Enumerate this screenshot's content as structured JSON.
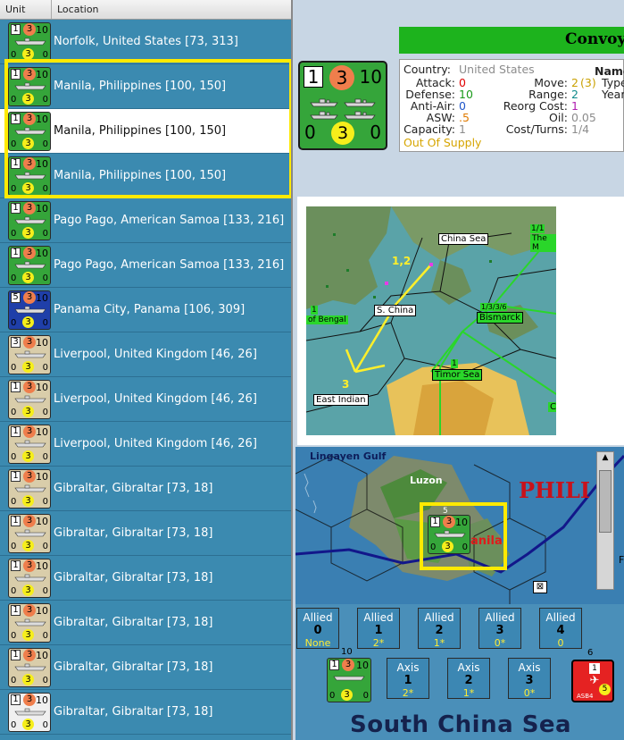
{
  "list": {
    "headers": {
      "unit": "Unit",
      "location": "Location"
    },
    "rows": [
      {
        "location": "Norfolk, United States [73, 313]",
        "color": "green",
        "a": "1",
        "m": "3",
        "r": "10",
        "d": "0",
        "s": "3",
        "x": "0"
      },
      {
        "location": "Manila, Philippines [100, 150]",
        "color": "green",
        "a": "1",
        "m": "3",
        "r": "10",
        "d": "0",
        "s": "3",
        "x": "0"
      },
      {
        "location": "Manila, Philippines [100, 150]",
        "color": "green",
        "a": "1",
        "m": "3",
        "r": "10",
        "d": "0",
        "s": "3",
        "x": "0",
        "selected": true
      },
      {
        "location": "Manila, Philippines [100, 150]",
        "color": "green",
        "a": "1",
        "m": "3",
        "r": "10",
        "d": "0",
        "s": "3",
        "x": "0"
      },
      {
        "location": "Pago Pago, American Samoa [133, 216]",
        "color": "green",
        "a": "1",
        "m": "3",
        "r": "10",
        "d": "0",
        "s": "3",
        "x": "0"
      },
      {
        "location": "Pago Pago, American Samoa [133, 216]",
        "color": "green",
        "a": "1",
        "m": "3",
        "r": "10",
        "d": "0",
        "s": "3",
        "x": "0"
      },
      {
        "location": "Panama City, Panama [106, 309]",
        "color": "blue",
        "a": "5",
        "m": "3",
        "r": "10",
        "d": "0",
        "s": "3",
        "x": "0"
      },
      {
        "location": "Liverpool, United Kingdom [46, 26]",
        "color": "tan",
        "a": "3",
        "m": "3",
        "r": "10",
        "d": "0",
        "s": "3",
        "x": "0"
      },
      {
        "location": "Liverpool, United Kingdom [46, 26]",
        "color": "tan",
        "a": "1",
        "m": "3",
        "r": "10",
        "d": "0",
        "s": "3",
        "x": "0"
      },
      {
        "location": "Liverpool, United Kingdom [46, 26]",
        "color": "tan",
        "a": "1",
        "m": "3",
        "r": "10",
        "d": "0",
        "s": "3",
        "x": "0"
      },
      {
        "location": "Gibraltar, Gibraltar [73, 18]",
        "color": "tan",
        "a": "1",
        "m": "3",
        "r": "10",
        "d": "0",
        "s": "3",
        "x": "0"
      },
      {
        "location": "Gibraltar, Gibraltar [73, 18]",
        "color": "tan",
        "a": "1",
        "m": "3",
        "r": "10",
        "d": "0",
        "s": "3",
        "x": "0"
      },
      {
        "location": "Gibraltar, Gibraltar [73, 18]",
        "color": "tan",
        "a": "1",
        "m": "3",
        "r": "10",
        "d": "0",
        "s": "3",
        "x": "0"
      },
      {
        "location": "Gibraltar, Gibraltar [73, 18]",
        "color": "tan",
        "a": "1",
        "m": "3",
        "r": "10",
        "d": "0",
        "s": "3",
        "x": "0"
      },
      {
        "location": "Gibraltar, Gibraltar [73, 18]",
        "color": "tan",
        "a": "1",
        "m": "3",
        "r": "10",
        "d": "0",
        "s": "3",
        "x": "0"
      },
      {
        "location": "Gibraltar, Gibraltar [73, 18]",
        "color": "white",
        "a": "1",
        "m": "3",
        "r": "10",
        "d": "0",
        "s": "3",
        "x": "0"
      }
    ]
  },
  "detail": {
    "title": "Convoy",
    "counter": {
      "a": "1",
      "m": "3",
      "r": "10",
      "d": "0",
      "s": "3",
      "x": "0"
    },
    "country_label": "Country:",
    "country": "United States",
    "attack_label": "Attack:",
    "attack": "0",
    "defense_label": "Defense:",
    "defense": "10",
    "antiair_label": "Anti-Air:",
    "antiair": "0",
    "asw_label": "ASW:",
    "asw": ".5",
    "capacity_label": "Capacity:",
    "capacity": "1",
    "move_label": "Move:",
    "move": "2",
    "move_extra": "(3)",
    "range_label": "Range:",
    "range": "2",
    "reorg_label": "Reorg Cost:",
    "reorg": "1",
    "oil_label": "Oil:",
    "oil": "0.05",
    "cost_label": "Cost/Turns:",
    "cost": "1/4",
    "supply": "Out Of Supply",
    "name_label": "Name",
    "type_label": "Type",
    "year_label": "Year"
  },
  "minimap": {
    "labels": {
      "china_sea": "China Sea",
      "the_m": "The M",
      "one_two": "1,2",
      "bengal": "of Bengal",
      "bengal_num": "1",
      "s_china": "S. China",
      "bismarck": "Bismarck",
      "bismarck_nums": "1/3/3/6",
      "three": "3",
      "timor_sea": "Timor Sea",
      "timor_num": "1",
      "east_indian": "East Indian",
      "edge_c": "C",
      "the_m_num": "1/1"
    }
  },
  "bigmap": {
    "lingayen": "Lingayen Gulf",
    "luzon": "Luzon",
    "phili": "PHILI",
    "manila": "anila",
    "counter": {
      "a": "1",
      "m": "3",
      "r": "10",
      "d": "0",
      "s": "3",
      "x": "0"
    },
    "stack_num": "5",
    "edge_f": "F"
  },
  "battle": {
    "allied": [
      {
        "title": "Allied",
        "num": "0",
        "sub": "None"
      },
      {
        "title": "Allied",
        "num": "1",
        "sub": "2*"
      },
      {
        "title": "Allied",
        "num": "2",
        "sub": "1*"
      },
      {
        "title": "Allied",
        "num": "3",
        "sub": "0*"
      },
      {
        "title": "Allied",
        "num": "4",
        "sub": "0"
      }
    ],
    "axis": [
      {
        "title": "Axis",
        "num": "1",
        "sub": "2*"
      },
      {
        "title": "Axis",
        "num": "2",
        "sub": "1*"
      },
      {
        "title": "Axis",
        "num": "3",
        "sub": "0*"
      }
    ],
    "left_counter": {
      "a": "1",
      "m": "3",
      "r": "10",
      "d": "0",
      "s": "3",
      "x": "0",
      "top": "10"
    },
    "right_counter": {
      "top": "6",
      "a": "1",
      "s": "5",
      "label": "ASB4"
    },
    "sea_name": "South China Sea"
  },
  "colors": {
    "green": "#35a53a",
    "blue": "#1f3fa9",
    "tan": "#d9cdaa",
    "white": "#f0f0f0",
    "highlight": "#ffea00",
    "red": "#e52222"
  }
}
